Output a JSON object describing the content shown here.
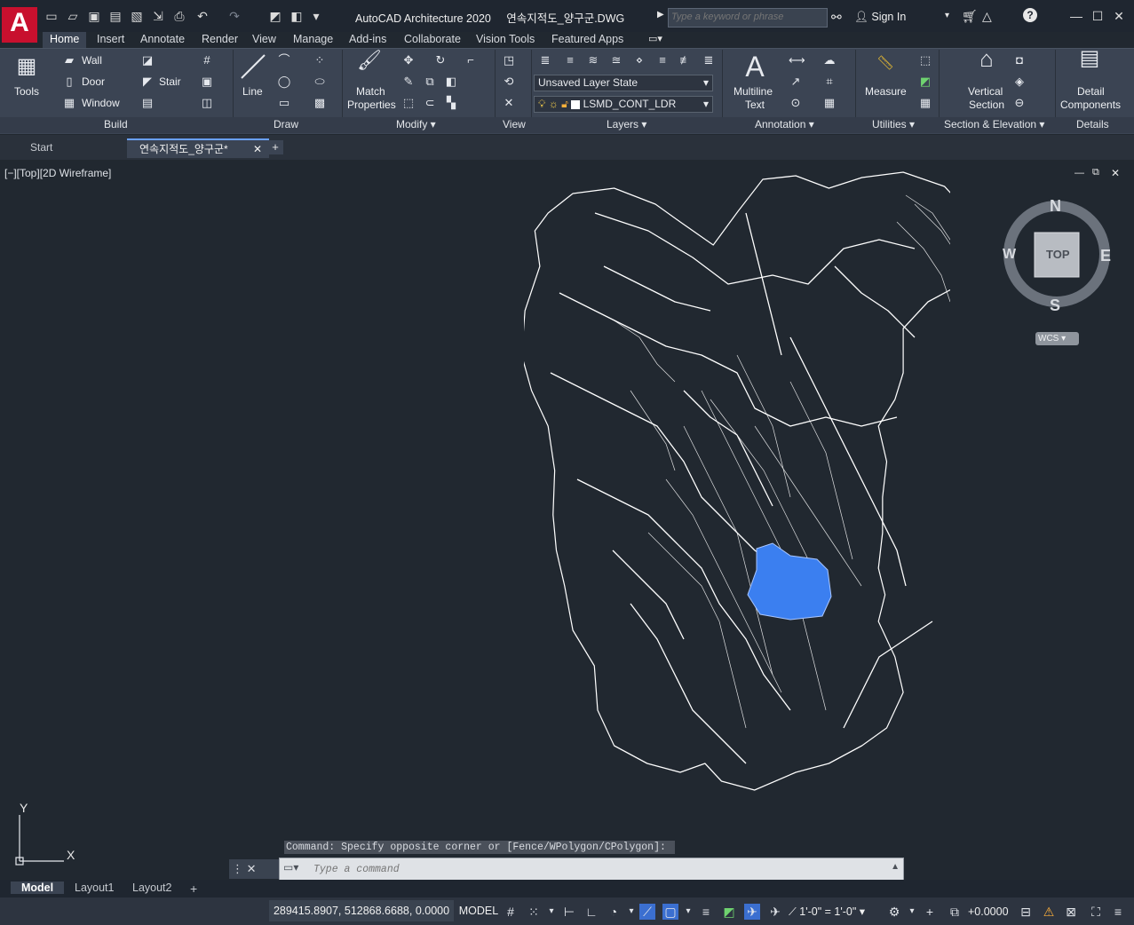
{
  "titlebar": {
    "app_name": "AutoCAD Architecture 2020",
    "file_name": "연속지적도_양구군.DWG",
    "search_placeholder": "Type a keyword or phrase",
    "signin_label": "Sign In"
  },
  "ribbon_tabs": [
    "Home",
    "Insert",
    "Annotate",
    "Render",
    "View",
    "Manage",
    "Add-ins",
    "Collaborate",
    "Vision Tools",
    "Featured Apps"
  ],
  "active_tab": "Home",
  "panels": {
    "build": {
      "title": "Build",
      "tools_label": "Tools",
      "wall": "Wall",
      "door": "Door",
      "window": "Window",
      "stair": "Stair"
    },
    "draw": {
      "title": "Draw",
      "line": "Line"
    },
    "modify": {
      "title": "Modify",
      "match_properties_1": "Match",
      "match_properties_2": "Properties"
    },
    "view": {
      "title": "View"
    },
    "layers": {
      "title": "Layers",
      "layer_state": "Unsaved Layer State",
      "current_layer": "LSMD_CONT_LDR"
    },
    "annotation": {
      "title": "Annotation",
      "multiline_1": "Multiline",
      "multiline_2": "Text"
    },
    "utilities": {
      "title": "Utilities",
      "measure": "Measure"
    },
    "section_elevation": {
      "title": "Section & Elevation",
      "vertical_1": "Vertical",
      "vertical_2": "Section"
    },
    "details": {
      "title": "Details",
      "detail_1": "Detail",
      "detail_2": "Components"
    }
  },
  "file_tabs": [
    {
      "label": "Start"
    },
    {
      "label": "연속지적도_양구군*"
    }
  ],
  "viewport": {
    "label": "[−][Top][2D Wireframe]",
    "viewcube": {
      "top": "TOP",
      "n": "N",
      "s": "S",
      "e": "E",
      "w": "W",
      "wcs": "WCS"
    },
    "ucs": {
      "y": "Y",
      "x": "X"
    }
  },
  "command": {
    "history": "Command: Specify opposite corner or [Fence/WPolygon/CPolygon]:",
    "placeholder": "Type a command"
  },
  "layout_tabs": [
    "Model",
    "Layout1",
    "Layout2"
  ],
  "statusbar": {
    "coordinates": "289415.8907, 512868.6688, 0.0000",
    "model": "MODEL",
    "scale": "1'-0\" = 1'-0\"",
    "elevation": "+0.0000"
  },
  "colors": {
    "accent": "#c8102e",
    "selection": "#3b7ff0",
    "drawing": "#ffffff",
    "background": "#212830"
  }
}
